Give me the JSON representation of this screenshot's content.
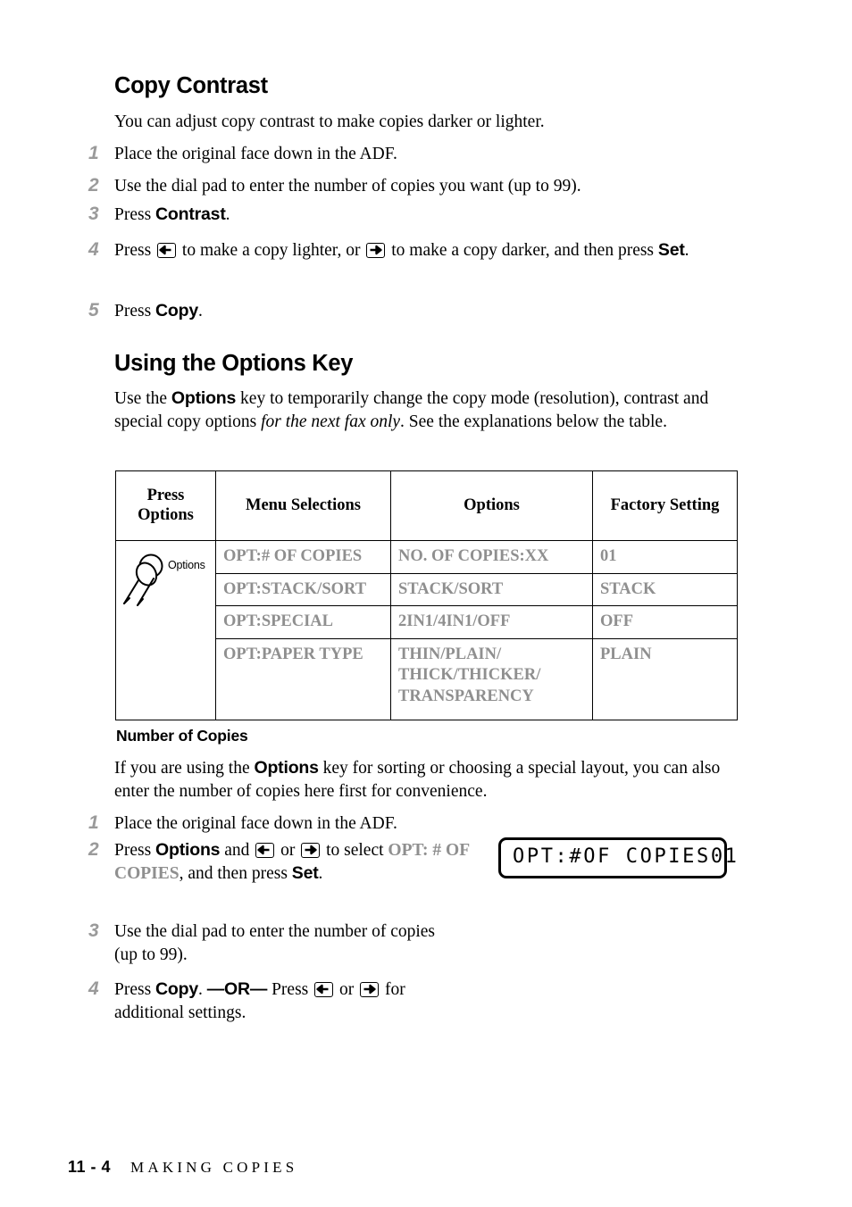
{
  "document": {
    "footer": {
      "page_number": "11 - 4",
      "chapter": "MAKING COPIES"
    }
  },
  "sections": [
    {
      "id": "copy-contrast",
      "title": "Copy Contrast",
      "intro": "You can adjust copy contrast to make copies darker or lighter.",
      "steps": [
        {
          "num": "1",
          "text": "Place the original face down in the ADF."
        },
        {
          "num": "2",
          "text": "Use the dial pad to enter the number of copies you want (up to 99)."
        },
        {
          "num": "3",
          "text_pre": "Press ",
          "keyword": "Contrast",
          "text_post": "."
        },
        {
          "num": "4",
          "t1": "Press ",
          "icon1": "left-arrow-key-icon",
          "t2": " to make a copy lighter, or ",
          "icon2": "right-arrow-key-icon",
          "t3": " to make a copy darker, and then press ",
          "keyword": "Set",
          "t4": "."
        },
        {
          "num": "5",
          "text_pre": "Press ",
          "keyword": "Copy",
          "text_post": "."
        }
      ]
    },
    {
      "id": "using-options-key",
      "title": "Using the Options Key",
      "intro": {
        "p1": "Use the ",
        "kw1": "Options",
        "p2": " key to temporarily change the copy mode (resolution), contrast and special copy options ",
        "em1": "for the next fax only",
        "p3": ". See the explanations below the table."
      }
    }
  ],
  "options_table": {
    "headers": [
      "Press Options",
      "Menu Selections",
      "Options",
      "Factory Setting"
    ],
    "key_icon_label": "Options",
    "rows": [
      {
        "menu_selection": "OPT:# OF COPIES",
        "options": "NO. OF COPIES:XX",
        "factory_setting": "01"
      },
      {
        "menu_selection": "OPT:STACK/SORT",
        "options": "STACK/SORT",
        "factory_setting": "STACK"
      },
      {
        "menu_selection": "OPT:SPECIAL",
        "options": "2IN1/4IN1/OFF",
        "factory_setting": "OFF"
      },
      {
        "menu_selection": "OPT:PAPER TYPE",
        "options": "THIN/PLAIN/\nTHICK/THICKER/\nTRANSPARENCY",
        "factory_setting": "PLAIN"
      }
    ]
  },
  "number_of_copies": {
    "title": "Number of Copies",
    "intro": {
      "p1": "If you are using the ",
      "kw1": "Options",
      "p2": " key for sorting or choosing a special layout, you can also enter the number of copies here first for convenience."
    },
    "steps": [
      {
        "num": "1",
        "text": "Place the original face down in the ADF."
      },
      {
        "num": "2",
        "t1": "Press ",
        "kw1": "Options",
        "t2": " and ",
        "icon1": "left-arrow-key-icon",
        "t3": " or ",
        "icon2": "right-arrow-key-icon",
        "t4": " to select ",
        "lcd_name": "OPT: # OF COPIES",
        "t5": ", and then press ",
        "kw2": "Set",
        "t6": "."
      },
      {
        "num": "3",
        "text": "Use the dial pad to enter the number of copies (up to 99)."
      },
      {
        "num": "4",
        "t1": "Press ",
        "kw1": "Copy",
        "t2": ". ",
        "or_label": "—OR—",
        "t3": " Press ",
        "icon1": "left-arrow-key-icon",
        "t4": " or ",
        "icon2": "right-arrow-key-icon",
        "t5": " for additional settings."
      }
    ],
    "lcd_display": "OPT:#OF COPIES01"
  },
  "colors": {
    "gray_text": "#8f8f8f",
    "step_number": "#9a9a9a",
    "ink": "#000000",
    "paper": "#ffffff"
  }
}
